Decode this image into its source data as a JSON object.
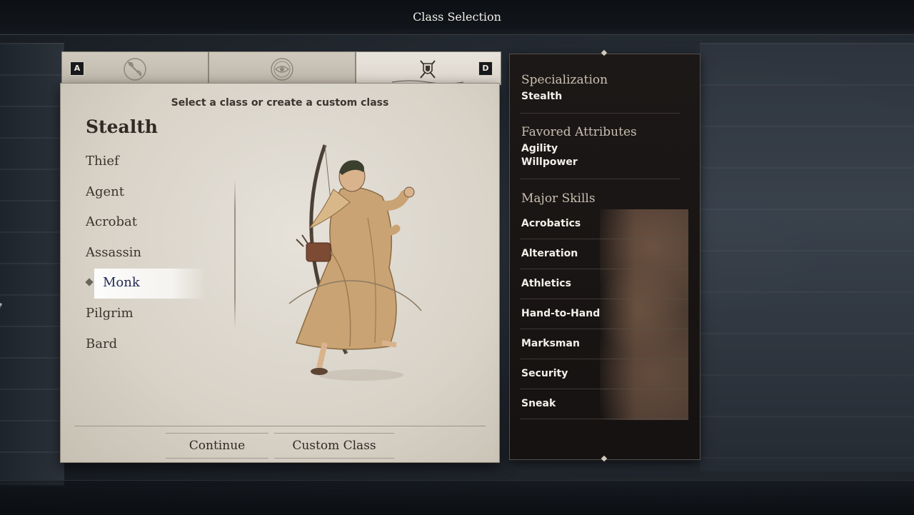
{
  "header": {
    "title": "Class Selection"
  },
  "tabs": [
    {
      "icon": "axe-icon",
      "key": "A"
    },
    {
      "icon": "eye-emblem-icon"
    },
    {
      "icon": "crossed-daggers-shield-icon",
      "key": "D"
    }
  ],
  "panel": {
    "subtitle": "Select a class or create a custom class",
    "category": "Stealth",
    "classes": [
      "Thief",
      "Agent",
      "Acrobat",
      "Assassin",
      "Monk",
      "Pilgrim",
      "Bard"
    ],
    "selected": "Monk"
  },
  "buttons": {
    "continue": "Continue",
    "custom_class": "Custom Class"
  },
  "info": {
    "specialization_heading": "Specialization",
    "specialization": "Stealth",
    "attributes_heading": "Favored Attributes",
    "attributes": [
      "Agility",
      "Willpower"
    ],
    "skills_heading": "Major Skills",
    "skills": [
      "Acrobatics",
      "Alteration",
      "Athletics",
      "Hand-to-Hand",
      "Marksman",
      "Security",
      "Sneak"
    ]
  },
  "colors": {
    "parchment": "#ddd7cd",
    "info_panel": "#1a1615",
    "selected_text": "#222a55"
  }
}
